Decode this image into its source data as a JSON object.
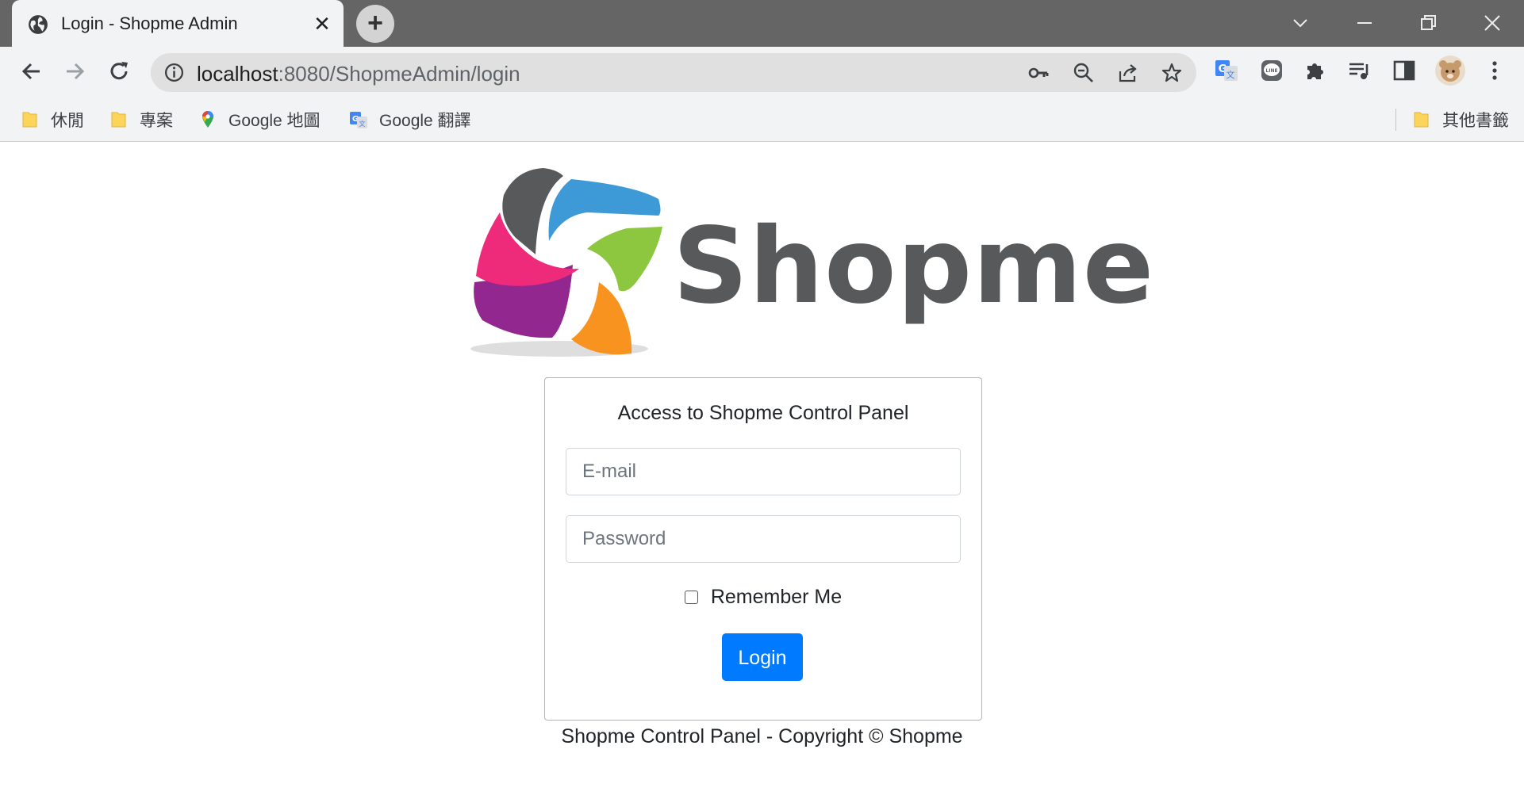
{
  "tab": {
    "title": "Login - Shopme Admin",
    "close_glyph": "✕",
    "icon": "globe-icon"
  },
  "newtab": {
    "glyph": "+"
  },
  "address_bar": {
    "host": "localhost",
    "path": ":8080/ShopmeAdmin/login"
  },
  "bookmarks": [
    {
      "label": "休閒",
      "icon": "folder-icon"
    },
    {
      "label": "專案",
      "icon": "folder-icon"
    },
    {
      "label": "Google 地圖",
      "icon": "google-maps-icon"
    },
    {
      "label": "Google 翻譯",
      "icon": "google-translate-icon"
    }
  ],
  "other_bookmarks": {
    "label": "其他書籤",
    "icon": "folder-icon"
  },
  "logo": {
    "text": "Shopme"
  },
  "login_form": {
    "title": "Access to Shopme Control Panel",
    "email_placeholder": "E-mail",
    "password_placeholder": "Password",
    "remember_label": "Remember Me",
    "remember_checked": false,
    "submit_label": "Login"
  },
  "footer": {
    "text": "Shopme Control Panel - Copyright © Shopme"
  },
  "colors": {
    "primary": "#007bff",
    "tabstrip": "#656565",
    "toolbar": "#f1f3f4",
    "logo_text": "#58595b"
  }
}
